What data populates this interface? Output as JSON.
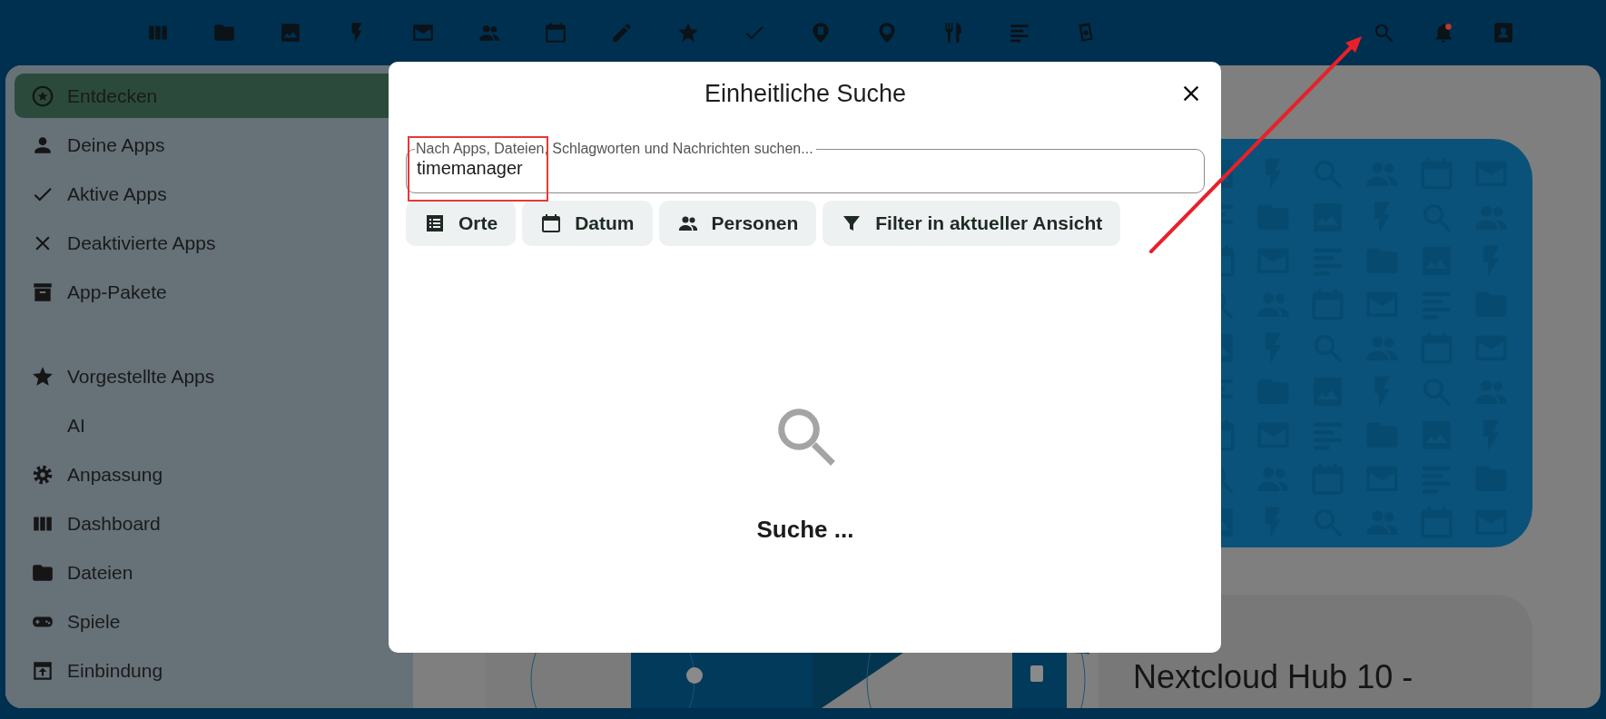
{
  "sidebar": {
    "items": [
      {
        "label": "Entdecken",
        "selected": true
      },
      {
        "label": "Deine Apps",
        "selected": false
      },
      {
        "label": "Aktive Apps",
        "selected": false
      },
      {
        "label": "Deaktivierte Apps",
        "selected": false
      },
      {
        "label": "App-Pakete",
        "selected": false
      },
      {
        "label": "Vorgestellte Apps",
        "selected": false
      },
      {
        "label": "AI",
        "selected": false
      },
      {
        "label": "Anpassung",
        "selected": false
      },
      {
        "label": "Dashboard",
        "selected": false
      },
      {
        "label": "Dateien",
        "selected": false
      },
      {
        "label": "Spiele",
        "selected": false
      },
      {
        "label": "Einbindung",
        "selected": false
      }
    ]
  },
  "dialog": {
    "title": "Einheitliche Suche",
    "search": {
      "label": "Nach Apps, Dateien, Schlagworten und Nachrichten suchen...",
      "value": "timemanager"
    },
    "filters": [
      "Orte",
      "Datum",
      "Personen",
      "Filter in aktueller Ansicht"
    ],
    "status": "Suche ..."
  },
  "content": {
    "card_title": "Nextcloud Hub 10 -"
  }
}
